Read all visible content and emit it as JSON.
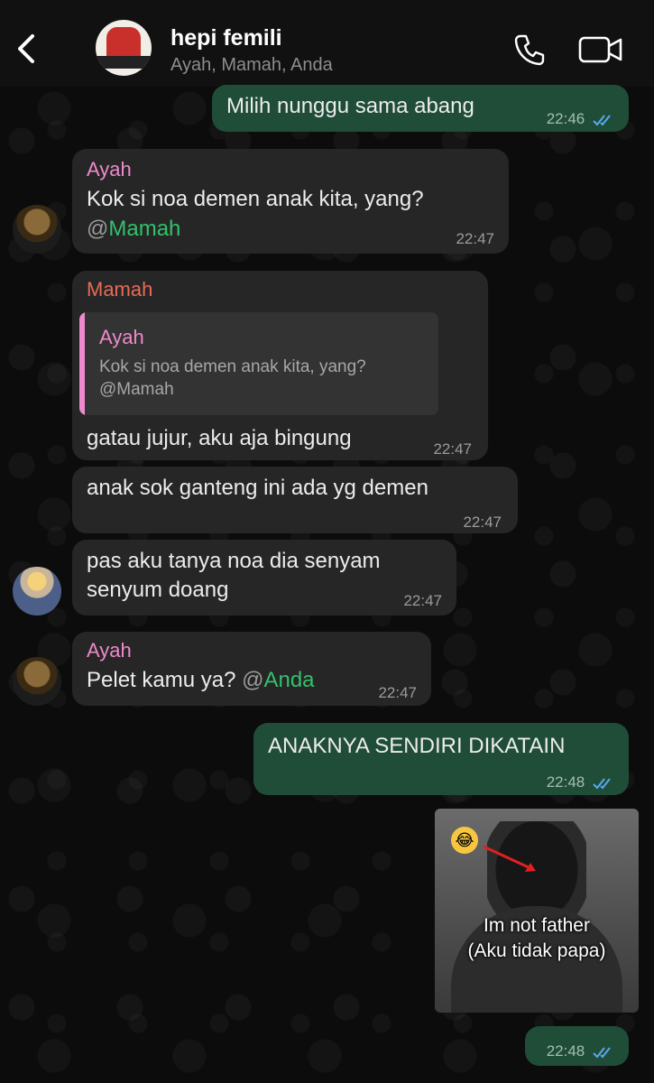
{
  "header": {
    "title": "hepi femili",
    "members": "Ayah, Mamah, Anda"
  },
  "icons": {
    "back": "chevron-left",
    "call": "phone",
    "video": "video-camera",
    "read": "double-check"
  },
  "colors": {
    "outgoing_bubble": "#1f4d38",
    "incoming_bubble": "#262626",
    "ayah_name": "#ee8acb",
    "mamah_name": "#e76b57",
    "mention": "#32c26b",
    "read_ticks": "#5aa9f0"
  },
  "messages": [
    {
      "text": "Milih nunggu sama abang",
      "time": "22:46"
    },
    {
      "sender": "Ayah",
      "text": "Kok si noa demen anak kita, yang?",
      "mention": "@Mamah",
      "time": "22:47"
    },
    {
      "sender": "Mamah",
      "quote": {
        "sender": "Ayah",
        "line1": "Kok si noa demen anak kita, yang?",
        "line2": "@Mamah"
      },
      "text": "gatau jujur, aku aja bingung",
      "time": "22:47"
    },
    {
      "text": "anak sok ganteng ini ada yg demen",
      "time": "22:47"
    },
    {
      "line1": "pas aku tanya noa dia senyam",
      "line2": "senyum doang",
      "time": "22:47"
    },
    {
      "sender": "Ayah",
      "text": "Pelet kamu ya?",
      "mention": "@Anda",
      "time": "22:47"
    },
    {
      "text": "ANAKNYA SENDIRI DIKATAIN",
      "time": "22:48"
    },
    {
      "image_caption_line1": "Im not father",
      "image_caption_line2": "(Aku tidak papa)",
      "time": "22:48"
    }
  ]
}
